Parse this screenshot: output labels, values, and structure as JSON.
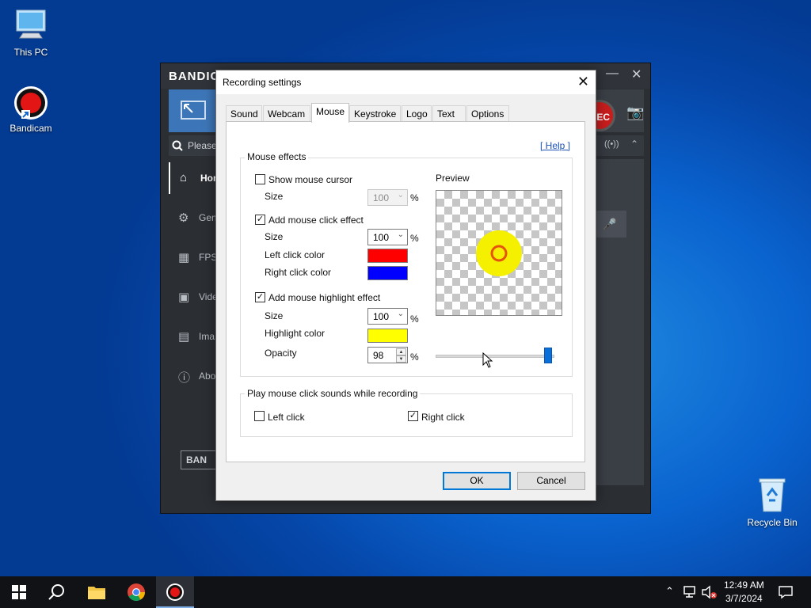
{
  "desktop": {
    "icons": [
      {
        "label": "This PC",
        "icon": "monitor-icon"
      },
      {
        "label": "Bandicam",
        "icon": "bandicam-icon"
      },
      {
        "label": "Recycle Bin",
        "icon": "recycle-bin-icon"
      }
    ]
  },
  "bandicam": {
    "brand": "BANDIC",
    "search_placeholder": "Please",
    "rec_label": "EC",
    "sidebar": [
      {
        "label": "Hor",
        "icon": "home-icon"
      },
      {
        "label": "Gen",
        "icon": "gear-icon"
      },
      {
        "label": "FPS",
        "icon": "fps-icon"
      },
      {
        "label": "Vide",
        "icon": "video-icon"
      },
      {
        "label": "Ima",
        "icon": "image-icon"
      },
      {
        "label": "Abo",
        "icon": "info-icon"
      }
    ],
    "banner": "BAN"
  },
  "dialog": {
    "title": "Recording settings",
    "tabs": [
      {
        "label": "Sound",
        "active": false
      },
      {
        "label": "Webcam",
        "active": false
      },
      {
        "label": "Mouse",
        "active": true
      },
      {
        "label": "Keystroke",
        "active": false
      },
      {
        "label": "Logo",
        "active": false
      },
      {
        "label": "Text",
        "active": false
      },
      {
        "label": "Options",
        "active": false
      }
    ],
    "help_link": "[ Help ]",
    "mouse_effects": {
      "title": "Mouse effects",
      "show_cursor": {
        "label": "Show mouse cursor",
        "checked": false,
        "size_label": "Size",
        "size_value": "100",
        "unit": "%"
      },
      "click_effect": {
        "label": "Add mouse click effect",
        "checked": true,
        "size_label": "Size",
        "size_value": "100",
        "unit": "%",
        "left_label": "Left click color",
        "left_color": "#ff0000",
        "right_label": "Right click color",
        "right_color": "#0000ff"
      },
      "highlight": {
        "label": "Add mouse highlight effect",
        "checked": true,
        "size_label": "Size",
        "size_value": "100",
        "unit": "%",
        "color_label": "Highlight color",
        "color": "#ffff00",
        "opacity_label": "Opacity",
        "opacity_value": "98",
        "opacity_unit": "%"
      },
      "preview_label": "Preview"
    },
    "sounds": {
      "title": "Play mouse click sounds while recording",
      "left": {
        "label": "Left click",
        "checked": false
      },
      "right": {
        "label": "Right click",
        "checked": true
      }
    },
    "ok": "OK",
    "cancel": "Cancel"
  },
  "taskbar": {
    "apps": [
      "start-icon",
      "search-icon",
      "file-explorer-icon",
      "chrome-icon",
      "bandicam-icon"
    ],
    "time": "12:49 AM",
    "date": "3/7/2024"
  }
}
